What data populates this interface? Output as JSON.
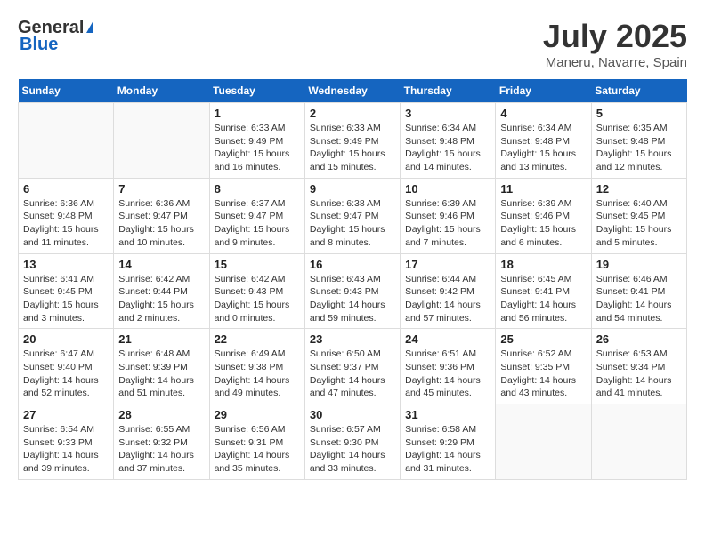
{
  "header": {
    "logo_general": "General",
    "logo_blue": "Blue",
    "month_year": "July 2025",
    "location": "Maneru, Navarre, Spain"
  },
  "days_of_week": [
    "Sunday",
    "Monday",
    "Tuesday",
    "Wednesday",
    "Thursday",
    "Friday",
    "Saturday"
  ],
  "weeks": [
    [
      {
        "day": "",
        "empty": true
      },
      {
        "day": "",
        "empty": true
      },
      {
        "day": "1",
        "sunrise": "Sunrise: 6:33 AM",
        "sunset": "Sunset: 9:49 PM",
        "daylight": "Daylight: 15 hours and 16 minutes."
      },
      {
        "day": "2",
        "sunrise": "Sunrise: 6:33 AM",
        "sunset": "Sunset: 9:49 PM",
        "daylight": "Daylight: 15 hours and 15 minutes."
      },
      {
        "day": "3",
        "sunrise": "Sunrise: 6:34 AM",
        "sunset": "Sunset: 9:48 PM",
        "daylight": "Daylight: 15 hours and 14 minutes."
      },
      {
        "day": "4",
        "sunrise": "Sunrise: 6:34 AM",
        "sunset": "Sunset: 9:48 PM",
        "daylight": "Daylight: 15 hours and 13 minutes."
      },
      {
        "day": "5",
        "sunrise": "Sunrise: 6:35 AM",
        "sunset": "Sunset: 9:48 PM",
        "daylight": "Daylight: 15 hours and 12 minutes."
      }
    ],
    [
      {
        "day": "6",
        "sunrise": "Sunrise: 6:36 AM",
        "sunset": "Sunset: 9:48 PM",
        "daylight": "Daylight: 15 hours and 11 minutes."
      },
      {
        "day": "7",
        "sunrise": "Sunrise: 6:36 AM",
        "sunset": "Sunset: 9:47 PM",
        "daylight": "Daylight: 15 hours and 10 minutes."
      },
      {
        "day": "8",
        "sunrise": "Sunrise: 6:37 AM",
        "sunset": "Sunset: 9:47 PM",
        "daylight": "Daylight: 15 hours and 9 minutes."
      },
      {
        "day": "9",
        "sunrise": "Sunrise: 6:38 AM",
        "sunset": "Sunset: 9:47 PM",
        "daylight": "Daylight: 15 hours and 8 minutes."
      },
      {
        "day": "10",
        "sunrise": "Sunrise: 6:39 AM",
        "sunset": "Sunset: 9:46 PM",
        "daylight": "Daylight: 15 hours and 7 minutes."
      },
      {
        "day": "11",
        "sunrise": "Sunrise: 6:39 AM",
        "sunset": "Sunset: 9:46 PM",
        "daylight": "Daylight: 15 hours and 6 minutes."
      },
      {
        "day": "12",
        "sunrise": "Sunrise: 6:40 AM",
        "sunset": "Sunset: 9:45 PM",
        "daylight": "Daylight: 15 hours and 5 minutes."
      }
    ],
    [
      {
        "day": "13",
        "sunrise": "Sunrise: 6:41 AM",
        "sunset": "Sunset: 9:45 PM",
        "daylight": "Daylight: 15 hours and 3 minutes."
      },
      {
        "day": "14",
        "sunrise": "Sunrise: 6:42 AM",
        "sunset": "Sunset: 9:44 PM",
        "daylight": "Daylight: 15 hours and 2 minutes."
      },
      {
        "day": "15",
        "sunrise": "Sunrise: 6:42 AM",
        "sunset": "Sunset: 9:43 PM",
        "daylight": "Daylight: 15 hours and 0 minutes."
      },
      {
        "day": "16",
        "sunrise": "Sunrise: 6:43 AM",
        "sunset": "Sunset: 9:43 PM",
        "daylight": "Daylight: 14 hours and 59 minutes."
      },
      {
        "day": "17",
        "sunrise": "Sunrise: 6:44 AM",
        "sunset": "Sunset: 9:42 PM",
        "daylight": "Daylight: 14 hours and 57 minutes."
      },
      {
        "day": "18",
        "sunrise": "Sunrise: 6:45 AM",
        "sunset": "Sunset: 9:41 PM",
        "daylight": "Daylight: 14 hours and 56 minutes."
      },
      {
        "day": "19",
        "sunrise": "Sunrise: 6:46 AM",
        "sunset": "Sunset: 9:41 PM",
        "daylight": "Daylight: 14 hours and 54 minutes."
      }
    ],
    [
      {
        "day": "20",
        "sunrise": "Sunrise: 6:47 AM",
        "sunset": "Sunset: 9:40 PM",
        "daylight": "Daylight: 14 hours and 52 minutes."
      },
      {
        "day": "21",
        "sunrise": "Sunrise: 6:48 AM",
        "sunset": "Sunset: 9:39 PM",
        "daylight": "Daylight: 14 hours and 51 minutes."
      },
      {
        "day": "22",
        "sunrise": "Sunrise: 6:49 AM",
        "sunset": "Sunset: 9:38 PM",
        "daylight": "Daylight: 14 hours and 49 minutes."
      },
      {
        "day": "23",
        "sunrise": "Sunrise: 6:50 AM",
        "sunset": "Sunset: 9:37 PM",
        "daylight": "Daylight: 14 hours and 47 minutes."
      },
      {
        "day": "24",
        "sunrise": "Sunrise: 6:51 AM",
        "sunset": "Sunset: 9:36 PM",
        "daylight": "Daylight: 14 hours and 45 minutes."
      },
      {
        "day": "25",
        "sunrise": "Sunrise: 6:52 AM",
        "sunset": "Sunset: 9:35 PM",
        "daylight": "Daylight: 14 hours and 43 minutes."
      },
      {
        "day": "26",
        "sunrise": "Sunrise: 6:53 AM",
        "sunset": "Sunset: 9:34 PM",
        "daylight": "Daylight: 14 hours and 41 minutes."
      }
    ],
    [
      {
        "day": "27",
        "sunrise": "Sunrise: 6:54 AM",
        "sunset": "Sunset: 9:33 PM",
        "daylight": "Daylight: 14 hours and 39 minutes."
      },
      {
        "day": "28",
        "sunrise": "Sunrise: 6:55 AM",
        "sunset": "Sunset: 9:32 PM",
        "daylight": "Daylight: 14 hours and 37 minutes."
      },
      {
        "day": "29",
        "sunrise": "Sunrise: 6:56 AM",
        "sunset": "Sunset: 9:31 PM",
        "daylight": "Daylight: 14 hours and 35 minutes."
      },
      {
        "day": "30",
        "sunrise": "Sunrise: 6:57 AM",
        "sunset": "Sunset: 9:30 PM",
        "daylight": "Daylight: 14 hours and 33 minutes."
      },
      {
        "day": "31",
        "sunrise": "Sunrise: 6:58 AM",
        "sunset": "Sunset: 9:29 PM",
        "daylight": "Daylight: 14 hours and 31 minutes."
      },
      {
        "day": "",
        "empty": true
      },
      {
        "day": "",
        "empty": true
      }
    ]
  ]
}
